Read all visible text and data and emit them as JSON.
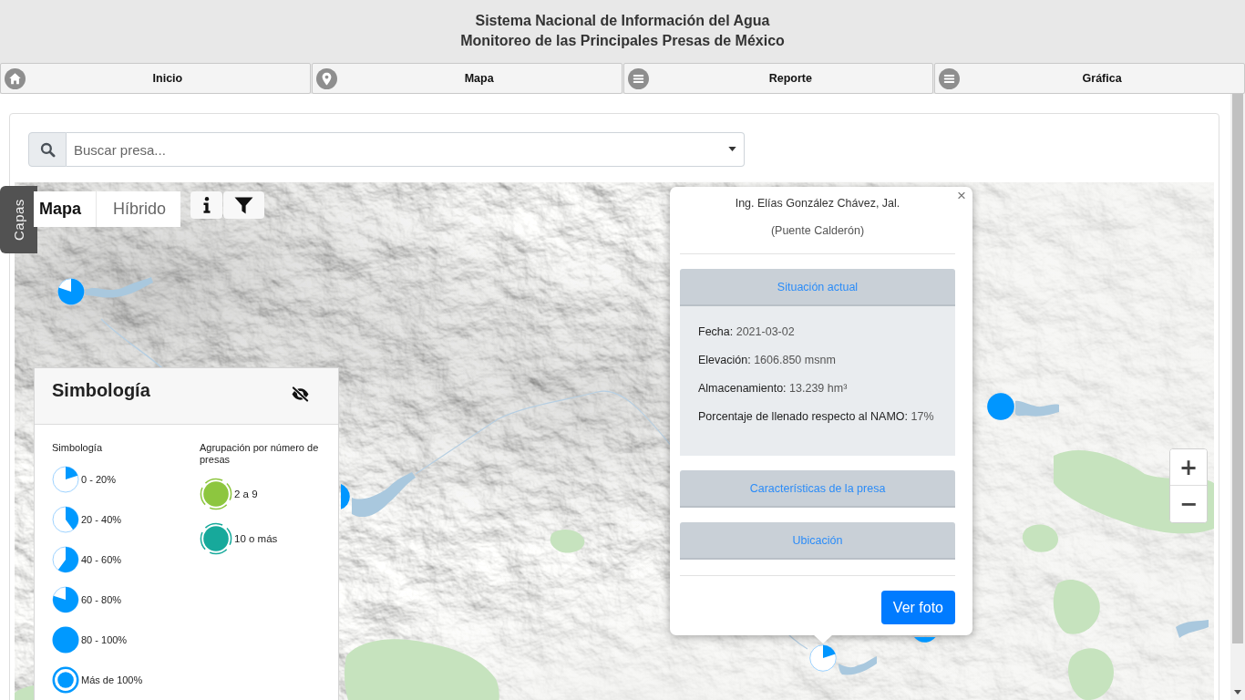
{
  "header": {
    "title": "Sistema Nacional de Información del Agua",
    "subtitle": "Monitoreo de las Principales Presas de México"
  },
  "nav": [
    {
      "label": "Inicio",
      "kind": "home"
    },
    {
      "label": "Mapa",
      "kind": "pin"
    },
    {
      "label": "Reporte",
      "kind": "menu"
    },
    {
      "label": "Gráfica",
      "kind": "menu"
    }
  ],
  "search": {
    "placeholder": "Buscar presa..."
  },
  "map": {
    "layers_tab": "Capas",
    "base_layers": [
      {
        "label": "Mapa",
        "selected": true
      },
      {
        "label": "Híbrido",
        "selected": false
      }
    ],
    "markers": [
      {
        "kind": "pie80"
      },
      {
        "kind": "full"
      },
      {
        "kind": "full"
      },
      {
        "kind": "full"
      },
      {
        "kind": "pie20"
      }
    ],
    "zoom_in": "+",
    "zoom_out": "−"
  },
  "legend": {
    "title": "Simbología",
    "fill_heading": "Simbología",
    "fill_items": [
      {
        "label": "0 - 20%",
        "kind": "pie20"
      },
      {
        "label": "20 - 40%",
        "kind": "pie40"
      },
      {
        "label": "40 - 60%",
        "kind": "pie60"
      },
      {
        "label": "60 - 80%",
        "kind": "pie80"
      },
      {
        "label": "80 - 100%",
        "kind": "full"
      },
      {
        "label": "Más de 100%",
        "kind": "ring"
      }
    ],
    "cluster_heading": "Agrupación por número de presas",
    "cluster_items": [
      {
        "label": "2 a 9",
        "color": "#8dc63f"
      },
      {
        "label": "10 o más",
        "color": "#17a99b"
      }
    ]
  },
  "popup": {
    "close": "×",
    "title": "Ing. Elías González Chávez, Jal.",
    "subtitle": "(Puente Calderón)",
    "sections": [
      {
        "label": "Situación actual",
        "expanded": true,
        "fields": [
          {
            "label": "Fecha:",
            "value": "2021-03-02"
          },
          {
            "label": "Elevación:",
            "value": "1606.850 msnm"
          },
          {
            "label": "Almacenamiento:",
            "value": "13.239 hm³"
          },
          {
            "label": "Porcentaje de llenado respecto al NAMO:",
            "value": "17%"
          }
        ]
      },
      {
        "label": "Características de la presa",
        "expanded": false
      },
      {
        "label": "Ubicación",
        "expanded": false
      }
    ],
    "photo_button": "Ver foto"
  }
}
